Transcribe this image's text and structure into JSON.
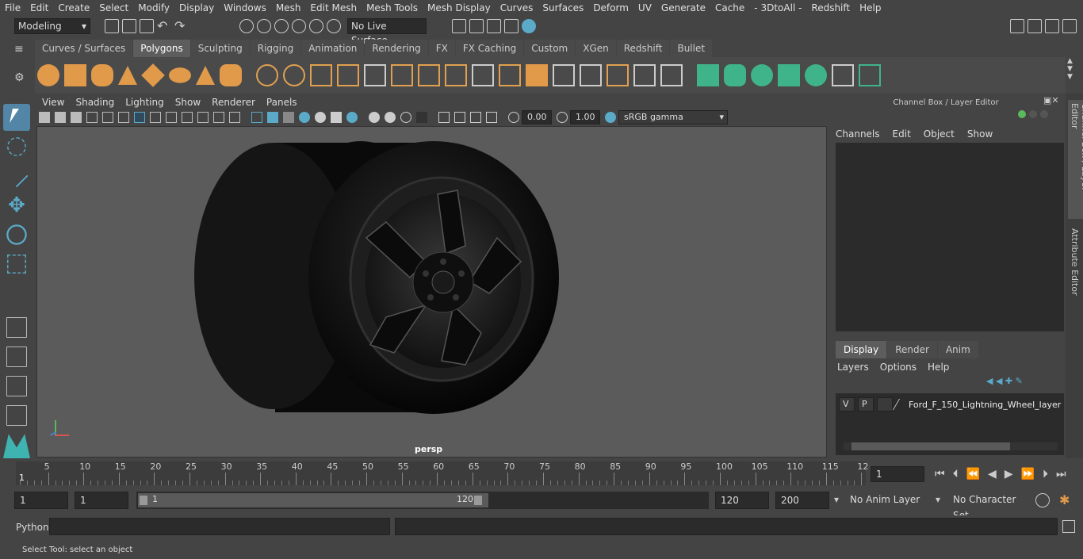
{
  "menubar": [
    "File",
    "Edit",
    "Create",
    "Select",
    "Modify",
    "Display",
    "Windows",
    "Mesh",
    "Edit Mesh",
    "Mesh Tools",
    "Mesh Display",
    "Curves",
    "Surfaces",
    "Deform",
    "UV",
    "Generate",
    "Cache",
    "- 3DtoAll -",
    "Redshift",
    "Help"
  ],
  "status": {
    "mode": "Modeling",
    "live_surface": "No Live Surface"
  },
  "shelf_tabs": [
    "Curves / Surfaces",
    "Polygons",
    "Sculpting",
    "Rigging",
    "Animation",
    "Rendering",
    "FX",
    "FX Caching",
    "Custom",
    "XGen",
    "Redshift",
    "Bullet"
  ],
  "active_shelf_tab": "Polygons",
  "viewport_menu": [
    "View",
    "Shading",
    "Lighting",
    "Show",
    "Renderer",
    "Panels"
  ],
  "viewport_toolbar": {
    "exposure": "0.00",
    "gamma": "1.00",
    "color_space": "sRGB gamma"
  },
  "viewport": {
    "camera_label": "persp"
  },
  "channel_box": {
    "title": "Channel Box / Layer Editor",
    "menu": [
      "Channels",
      "Edit",
      "Object",
      "Show"
    ]
  },
  "layer_editor": {
    "tabs": [
      "Display",
      "Render",
      "Anim"
    ],
    "active_tab": "Display",
    "menu": [
      "Layers",
      "Options",
      "Help"
    ],
    "layer": {
      "v": "V",
      "p": "P",
      "name": "Ford_F_150_Lightning_Wheel_layer"
    }
  },
  "side_tabs": [
    "Channel Box / Layer Editor",
    "Attribute Editor"
  ],
  "timeline": {
    "ticks": [
      "5",
      "10",
      "15",
      "20",
      "25",
      "30",
      "35",
      "40",
      "45",
      "50",
      "55",
      "60",
      "65",
      "70",
      "75",
      "80",
      "85",
      "90",
      "95",
      "100",
      "105",
      "110",
      "115",
      "12"
    ],
    "start_marker": "1",
    "current_frame": "1"
  },
  "range": {
    "start": "1",
    "start2": "1",
    "slider_start": "1",
    "slider_end": "120",
    "end": "120",
    "end2": "200",
    "anim_layer": "No Anim Layer",
    "char_set": "No Character Set"
  },
  "cmd": {
    "label": "Python"
  },
  "help_line": "Select Tool: select an object",
  "colors": {
    "accent": "#5285a6",
    "shelf_orange": "#e09a4a",
    "shelf_green": "#3fb38a"
  }
}
